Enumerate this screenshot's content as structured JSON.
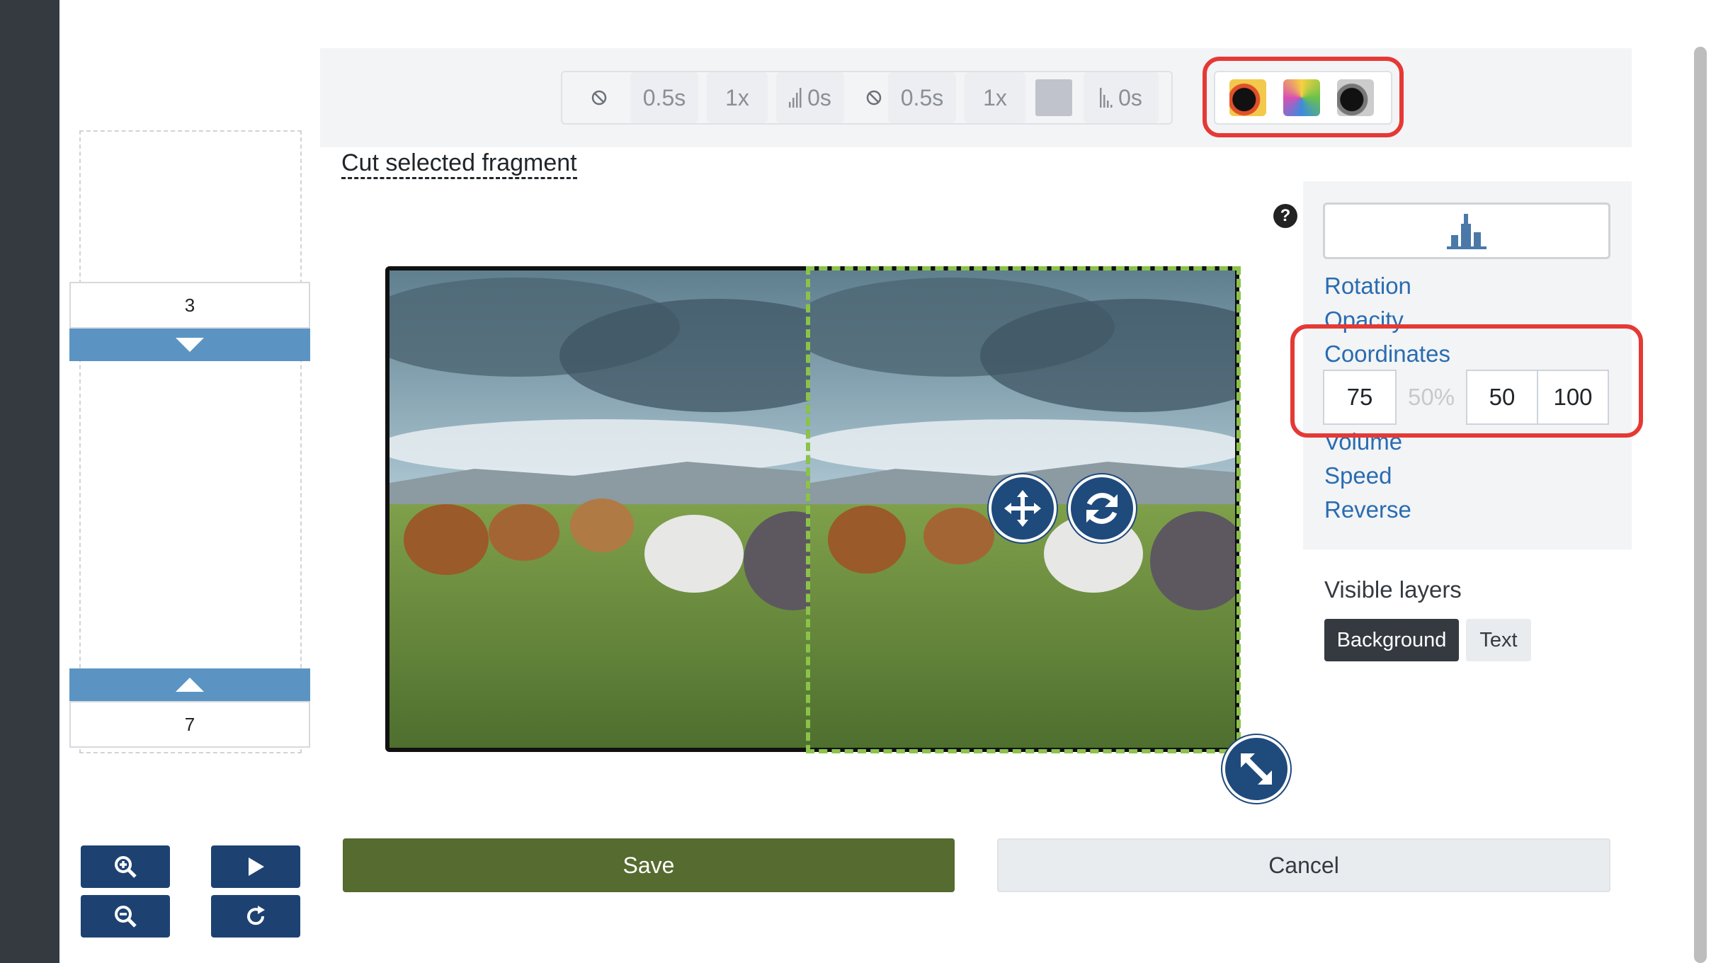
{
  "toolbar": {
    "fade_in_duration": "0.5s",
    "speed_1": "1x",
    "volume_delay_1": "0s",
    "fade_out_duration": "0.5s",
    "speed_2": "1x",
    "volume_delay_2": "0s"
  },
  "editor": {
    "cut_link": "Cut selected fragment"
  },
  "slider": {
    "start_value": "3",
    "end_value": "7"
  },
  "properties": {
    "items": [
      "Rotation",
      "Opacity",
      "Coordinates",
      "Volume",
      "Speed",
      "Reverse"
    ],
    "coordinates": {
      "x": "75",
      "percent": "50%",
      "y": "50",
      "size": "100"
    }
  },
  "layers": {
    "label": "Visible layers",
    "background": "Background",
    "text": "Text"
  },
  "actions": {
    "save": "Save",
    "cancel": "Cancel"
  },
  "icons": [
    "ban-icon",
    "volume-bars-icon",
    "color-swatch-icon",
    "filter-thumb",
    "help-icon",
    "skyline-icon",
    "move-icon",
    "sync-icon",
    "resize-icon",
    "zoom-in-icon",
    "zoom-out-icon",
    "play-icon",
    "refresh-icon",
    "caret-down-icon",
    "caret-up-icon"
  ],
  "colors": {
    "save": "#556b2f",
    "link": "#2a6cb0",
    "highlight": "#e53935",
    "nav_button": "#1d4272",
    "slider_button": "#5b94c3"
  }
}
